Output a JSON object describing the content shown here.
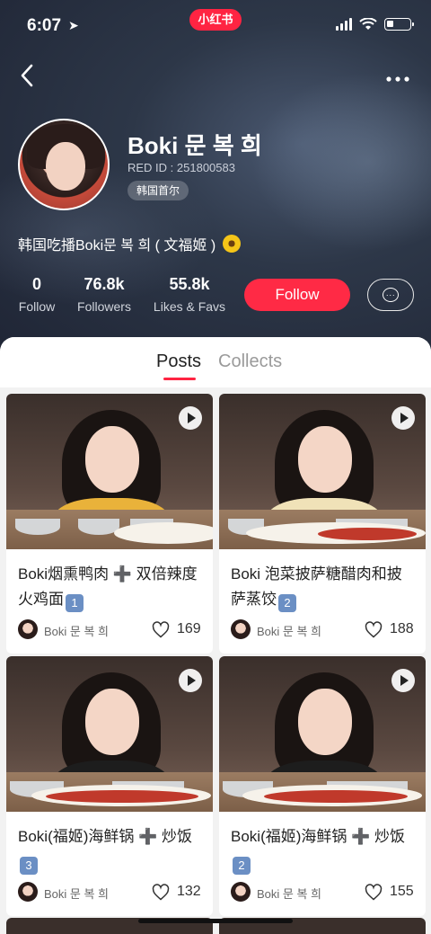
{
  "status_bar": {
    "time": "6:07",
    "app_logo": "小红书"
  },
  "header": {
    "back_icon": "chevron-left-icon",
    "more_icon": "more-horizontal-icon"
  },
  "profile": {
    "name": "Boki 문 복 희",
    "red_id": "RED ID : 251800583",
    "location": "韩国首尔",
    "bio": "韩国吃播Boki문 복 희 ( 文福姬 )",
    "bio_emoji": "sunflower-icon"
  },
  "stats": [
    {
      "value": "0",
      "label": "Follow"
    },
    {
      "value": "76.8k",
      "label": "Followers"
    },
    {
      "value": "55.8k",
      "label": "Likes & Favs"
    }
  ],
  "actions": {
    "follow_label": "Follow",
    "message_icon": "chat-bubble-icon"
  },
  "tabs": [
    {
      "label": "Posts",
      "active": true
    },
    {
      "label": "Collects",
      "active": false
    }
  ],
  "posts": [
    {
      "title": "Boki烟熏鸭肉 ➕ 双倍辣度火鸡面",
      "badge": "1",
      "author": "Boki 문 복 희",
      "likes": "169",
      "shirt": "#e9b23a"
    },
    {
      "title": "Boki 泡菜披萨糖醋肉和披萨蒸饺",
      "badge": "2",
      "author": "Boki 문 복 희",
      "likes": "188",
      "shirt": "#f0e2b8"
    },
    {
      "title": "Boki(福姬)海鲜锅 ➕ 炒饭",
      "badge": "3",
      "author": "Boki 문 복 희",
      "likes": "132",
      "shirt": "#1d1d1d"
    },
    {
      "title": "Boki(福姬)海鲜锅 ➕ 炒饭",
      "badge": "2",
      "author": "Boki 문 복 희",
      "likes": "155",
      "shirt": "#1d1d1d"
    }
  ],
  "colors": {
    "accent": "#ff2442",
    "header_bg": "#2d3748"
  }
}
